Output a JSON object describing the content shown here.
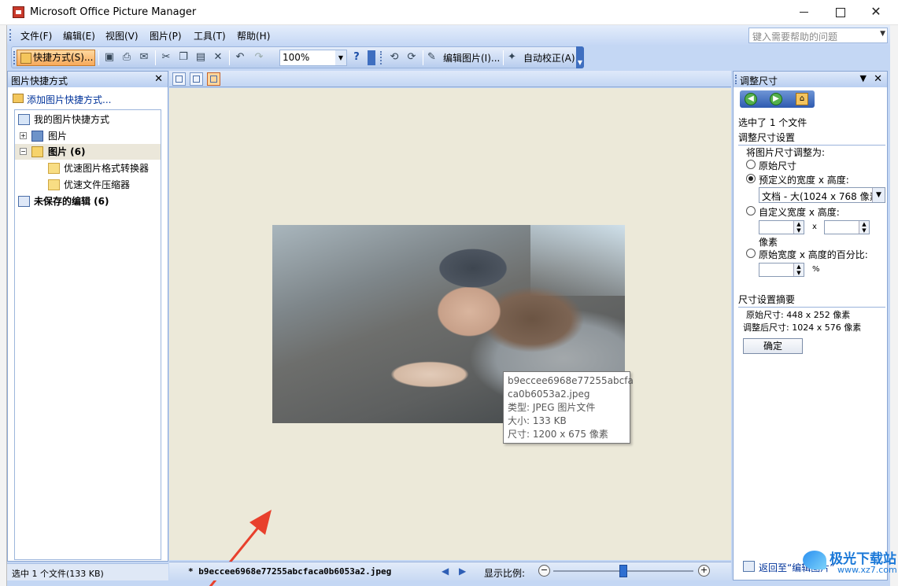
{
  "window": {
    "title": "Microsoft Office Picture Manager"
  },
  "menu": {
    "items": [
      "文件(F)",
      "编辑(E)",
      "视图(V)",
      "图片(P)",
      "工具(T)",
      "帮助(H)"
    ],
    "help_placeholder": "键入需要帮助的问题"
  },
  "toolbar": {
    "shortcuts_label": "快捷方式(S)...",
    "zoom_value": "100%",
    "edit_pictures_label": "编辑图片(I)...",
    "auto_correct_label": "自动校正(A)"
  },
  "left_pane": {
    "title": "图片快捷方式",
    "add_shortcut": "添加图片快捷方式...",
    "tree": {
      "root": "我的图片快捷方式",
      "pictures": "图片",
      "pictures_folder": "图片 (6)",
      "child1": "优速图片格式转换器",
      "child2": "优速文件压缩器",
      "unsaved": "未保存的编辑 (6)"
    },
    "status": "选中 1 个文件(133 KB)"
  },
  "center": {
    "tooltip": {
      "name_line1": "b9eccee6968e77255abcfa",
      "name_line2": "ca0b6053a2.jpeg",
      "type": "类型: JPEG 图片文件",
      "size": "大小: 133 KB",
      "dimensions": "尺寸: 1200 x 675 像素"
    },
    "status_filename": "* b9eccee6968e77255abcfaca0b6053a2.jpeg",
    "zoom_label": "显示比例:",
    "zoom_level": 0.5
  },
  "right_pane": {
    "title": "调整尺寸",
    "selected": "选中了 1 个文件",
    "settings_title": "调整尺寸设置",
    "resize_to": "将图片尺寸调整为:",
    "opt_original": "原始尺寸",
    "opt_predefined": "预定义的宽度 x 高度:",
    "predefined_value": "文档 - 大(1024 x 768 像素)",
    "opt_custom": "自定义宽度 x 高度:",
    "x": "x",
    "pixels": "像素",
    "opt_percent": "原始宽度 x 高度的百分比:",
    "percent_sign": "%",
    "summary_title": "尺寸设置摘要",
    "orig_size": "原始尺寸:   448 x 252 像素",
    "new_size": "调整后尺寸:  1024 x 576 像素",
    "ok": "确定",
    "back_link": "返回至“编辑图片”"
  },
  "watermark": {
    "name": "极光下载站",
    "url": "www.xz7.com"
  },
  "colors": {
    "accent": "#c4d7f4",
    "arrow": "#e8402c",
    "link": "#00339a"
  }
}
